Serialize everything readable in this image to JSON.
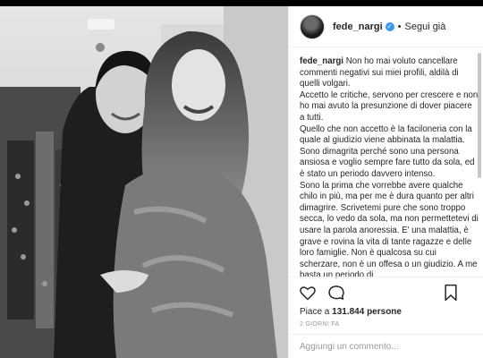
{
  "header": {
    "username": "fede_nargi",
    "verified_mark": "✓",
    "separator": "•",
    "follow_label": "Segui già"
  },
  "caption": {
    "username": "fede_nargi",
    "paragraphs": [
      "Non ho mai voluto cancellare commenti negativi sui miei profili, aldilà di quelli volgari.",
      "Accetto le critiche, servono per crescere e non ho mai avuto la presunzione di dover piacere a tutti.",
      "Quello che non accetto è la faciloneria con la quale al giudizio viene abbinata la malattia.",
      "Sono dimagrita perché sono una persona ansiosa e voglio sempre fare tutto da sola, ed è stato un periodo davvero intenso.",
      "Sono la prima che vorrebbe avere qualche chilo in più, ma per me è dura quanto per altri dimagrire. Scrivetemi pure che sono troppo secca, lo vedo da sola, ma non permettetevi di usare la parola anoressia. E' una malattia, è grave e rovina la vita di tante ragazze e delle loro famiglie. Non è qualcosa su cui scherzare, non è un offesa o un giudizio. A me basta un periodo di"
    ]
  },
  "actions": {
    "like_icon": "heart-icon",
    "comment_icon": "comment-icon",
    "save_icon": "bookmark-icon"
  },
  "likes": {
    "prefix": "Piace a ",
    "count": "131.844",
    "suffix": " persone"
  },
  "time_ago": "2 GIORNI FA",
  "comment_box": {
    "placeholder": "Aggiungi un commento..."
  },
  "colors": {
    "accent_verified": "#3897f0",
    "text": "#262626",
    "muted": "#999999",
    "border": "#efefef"
  }
}
